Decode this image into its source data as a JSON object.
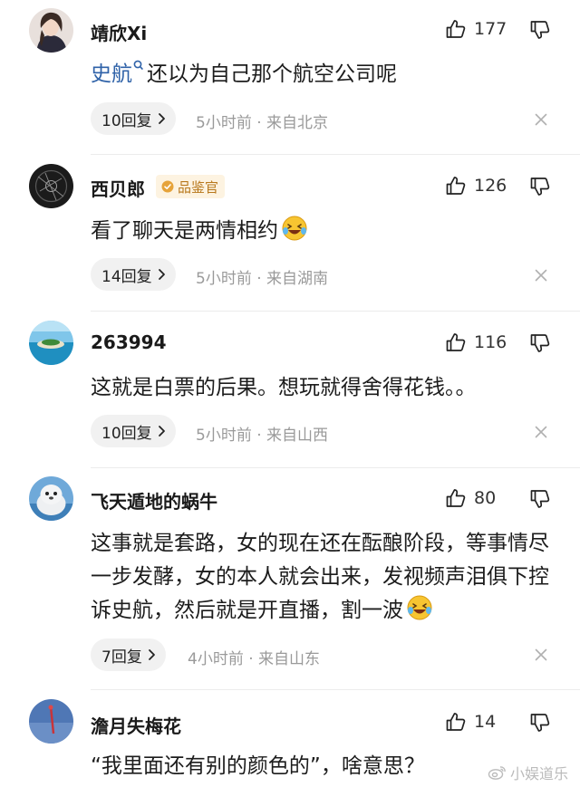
{
  "comments": [
    {
      "username": "靖欣Xi",
      "likes": "177",
      "mention": "史航",
      "text": "还以为自己那个航空公司呢",
      "replies": "10回复",
      "meta": "5小时前 · 来自北京"
    },
    {
      "username": "西贝郎",
      "badge": "品鉴官",
      "likes": "126",
      "text": "看了聊天是两情相约",
      "emoji": "laughing-crying-emoji",
      "replies": "14回复",
      "meta": "5小时前 · 来自湖南"
    },
    {
      "username": "263994",
      "likes": "116",
      "text": "这就是白票的后果。想玩就得舍得花钱。。",
      "replies": "10回复",
      "meta": "5小时前 · 来自山西"
    },
    {
      "username": "飞天遁地的蜗牛",
      "likes": "80",
      "text": "这事就是套路，女的现在还在酝酿阶段，等事情尽一步发酵，女的本人就会出来，发视频声泪俱下控诉史航，然后就是开直播，割一波",
      "emoji": "laughing-crying-emoji",
      "replies": "7回复",
      "meta": "4小时前 · 来自山东"
    },
    {
      "username": "澹月失梅花",
      "likes": "14",
      "text": "“我里面还有别的颜色的”，啥意思？"
    }
  ],
  "watermark": "小娱道乐",
  "colors": {
    "mention": "#2f62a8",
    "badge_bg": "#fdf3e1",
    "badge_text": "#b8781c",
    "pill_bg": "#f1f1f1",
    "meta_text": "#9a9a9a"
  },
  "icons": {
    "like": "thumbs-up-icon",
    "dislike": "thumbs-down-icon",
    "close": "close-icon",
    "chevron": "chevron-right-icon",
    "badge": "badge-icon",
    "mention": "mention-icon",
    "watermark": "weibo-logo-icon"
  }
}
